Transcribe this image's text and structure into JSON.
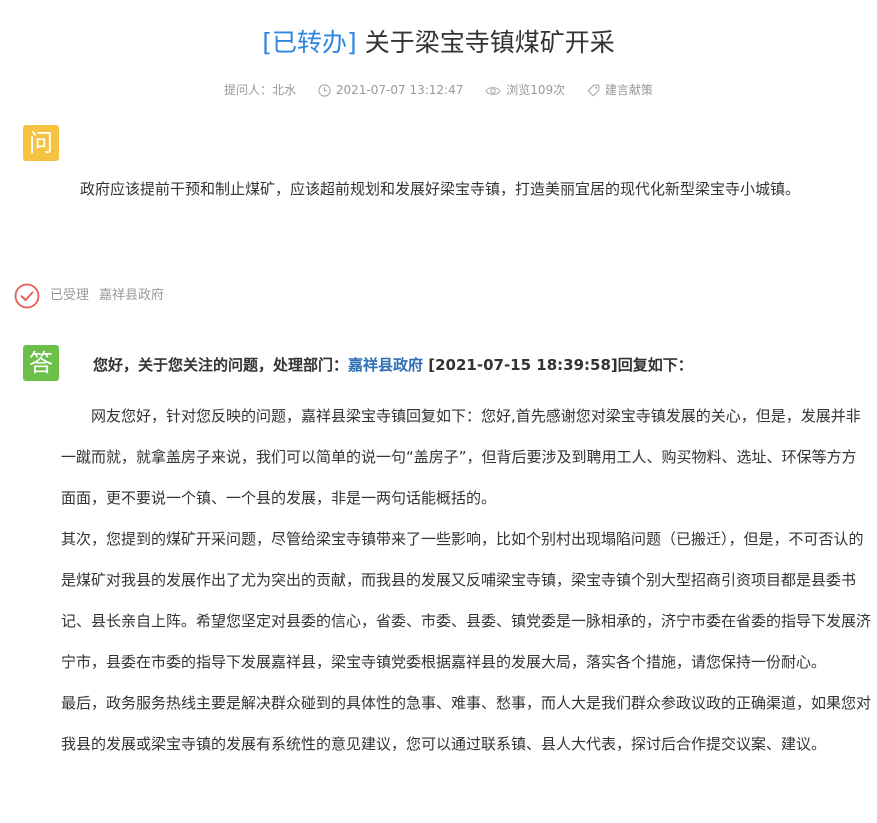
{
  "title": {
    "status": "[已转办]",
    "text": " 关于梁宝寺镇煤矿开采"
  },
  "meta": {
    "asker_label": "提问人：",
    "asker": "北水",
    "datetime": "2021-07-07 13:12:47",
    "views": "浏览109次",
    "category": "建言献策"
  },
  "question": {
    "badge": "问",
    "text": "政府应该提前干预和制止煤矿，应该超前规划和发展好梁宝寺镇，打造美丽宜居的现代化新型梁宝寺小城镇。"
  },
  "status": {
    "label": "已受理",
    "department": "嘉祥县政府"
  },
  "answer": {
    "badge": "答",
    "head_prefix": "您好，关于您关注的问题，处理部门：",
    "department": "嘉祥县政府",
    "head_suffix": " [2021-07-15 18:39:58]回复如下：",
    "paragraphs": [
      "网友您好，针对您反映的问题，嘉祥县梁宝寺镇回复如下：您好,首先感谢您对梁宝寺镇发展的关心，但是，发展并非一蹴而就，就拿盖房子来说，我们可以简单的说一句“盖房子”，但背后要涉及到聘用工人、购买物料、选址、环保等方方面面，更不要说一个镇、一个县的发展，非是一两句话能概括的。",
      "其次，您提到的煤矿开采问题，尽管给梁宝寺镇带来了一些影响，比如个别村出现塌陷问题（已搬迁），但是，不可否认的是煤矿对我县的发展作出了尤为突出的贡献，而我县的发展又反哺梁宝寺镇，梁宝寺镇个别大型招商引资项目都是县委书记、县长亲自上阵。希望您坚定对县委的信心，省委、市委、县委、镇党委是一脉相承的，济宁市委在省委的指导下发展济宁市，县委在市委的指导下发展嘉祥县，梁宝寺镇党委根据嘉祥县的发展大局，落实各个措施，请您保持一份耐心。",
      "最后，政务服务热线主要是解决群众碰到的具体性的急事、难事、愁事，而人大是我们群众参政议政的正确渠道，如果您对我县的发展或梁宝寺镇的发展有系统性的意见建议，您可以通过联系镇、县人大代表，探讨后合作提交议案、建议。"
    ]
  },
  "colors": {
    "status_blue": "#2e86de",
    "dept_blue": "#2e6fb4",
    "question_badge": "#f5c242",
    "answer_badge": "#6cc04a",
    "check_red": "#e85a5a"
  },
  "icons": [
    "clock-icon",
    "eye-icon",
    "tag-icon",
    "check-circle-icon"
  ]
}
